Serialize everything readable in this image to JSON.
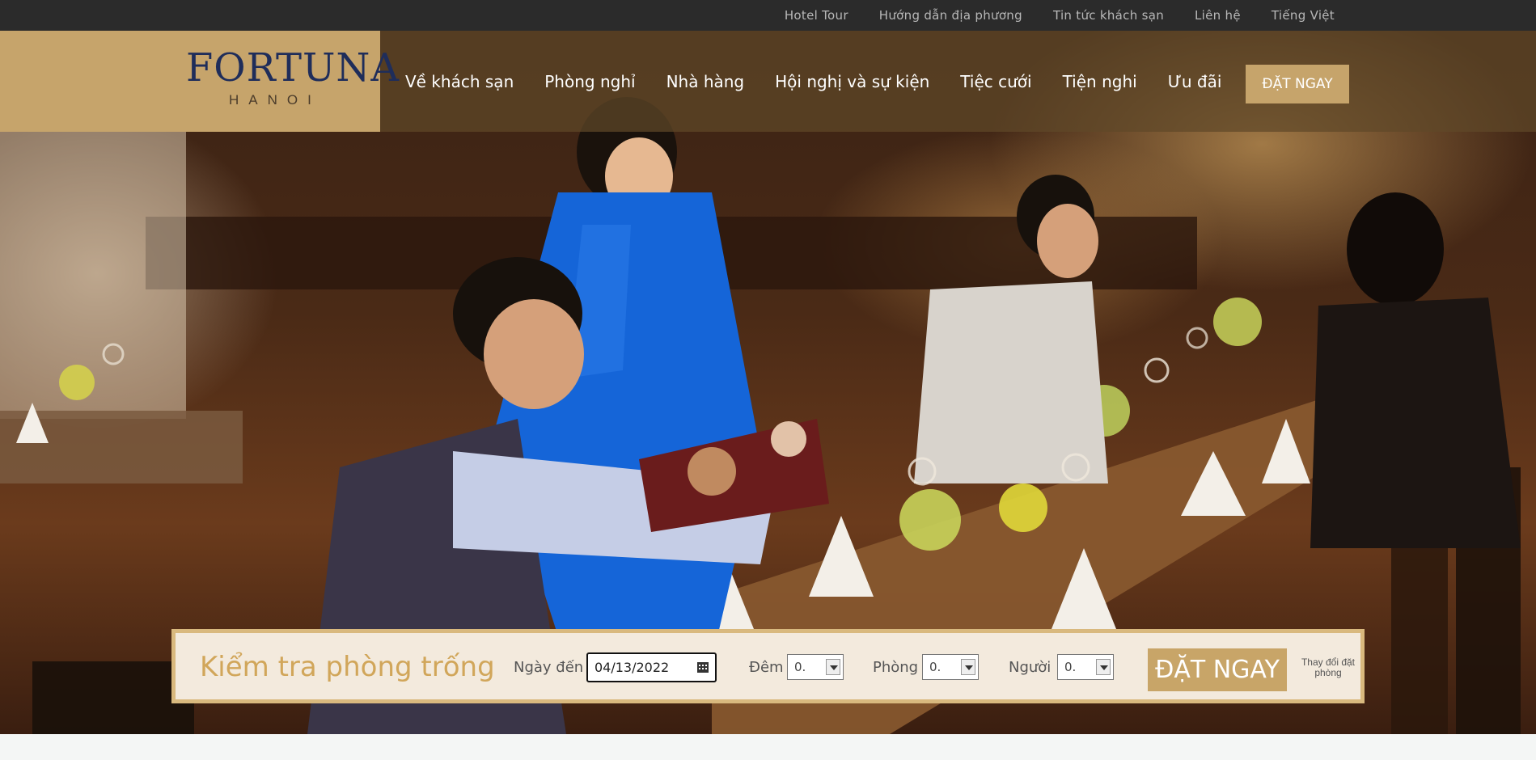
{
  "topbar": {
    "items": [
      "Hotel Tour",
      "Hướng dẫn địa phương",
      "Tin tức khách sạn",
      "Liên hệ",
      "Tiếng Việt"
    ]
  },
  "brand": {
    "name": "FORTUNA",
    "city": "HANOI",
    "color": "#1f2d5a",
    "accent": "#c6a46b"
  },
  "nav": {
    "items": [
      "Về khách sạn",
      "Phòng nghỉ",
      "Nhà hàng",
      "Hội nghị và sự kiện",
      "Tiệc cưới",
      "Tiện nghi",
      "Ưu đãi"
    ],
    "book_label": "ĐẶT NGAY"
  },
  "booking": {
    "title": "Kiểm tra phòng trống",
    "arrival_label": "Ngày đến",
    "arrival_value": "04/13/2022",
    "nights_label": "Đêm",
    "nights_value": "0.",
    "rooms_label": "Phòng",
    "rooms_value": "0.",
    "guests_label": "Người",
    "guests_value": "0.",
    "book_label": "ĐẶT NGAY",
    "change_label": "Thay đổi đặt phòng"
  }
}
